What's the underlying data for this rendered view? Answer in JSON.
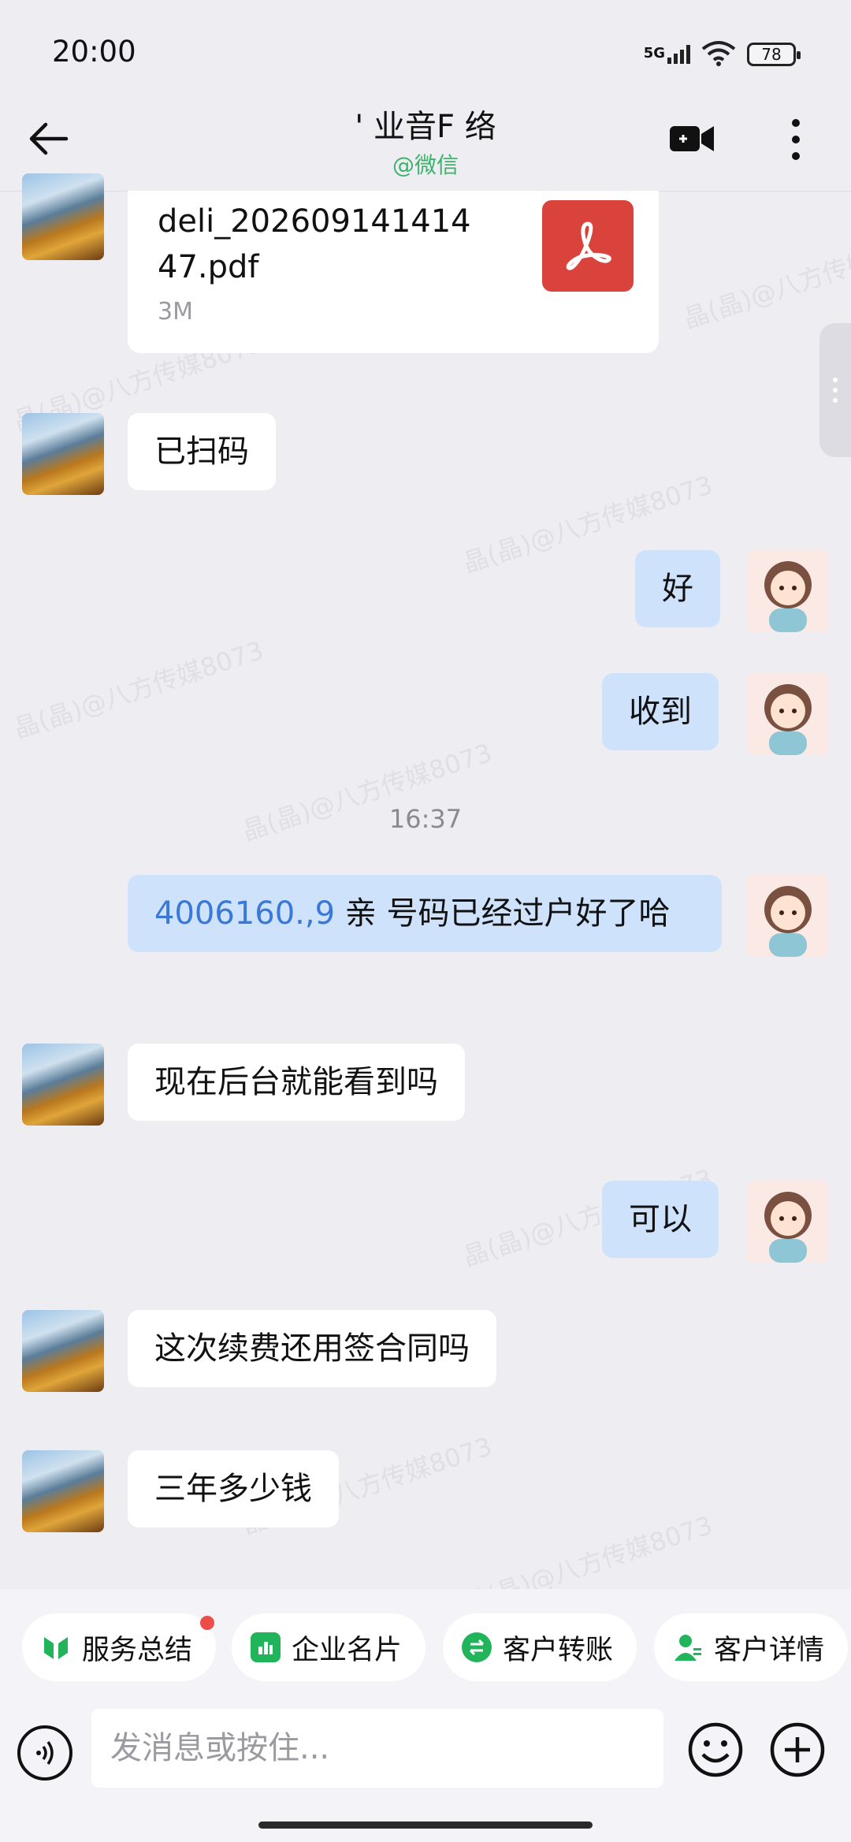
{
  "status_bar": {
    "time": "20:00",
    "network": "5G",
    "battery": "78"
  },
  "header": {
    "title": "' 业​音​F 络",
    "subtitle": "@微信"
  },
  "file_message": {
    "file_name": "deli_20260914141447.pdf",
    "file_size": "3M"
  },
  "messages": [
    {
      "side": "in",
      "text": "已扫码"
    },
    {
      "side": "out",
      "text": "好"
    },
    {
      "side": "out",
      "text": "收到"
    },
    {
      "side": "out",
      "phone": "4006160.,9",
      "text": " 亲 号码已经过户好了哈"
    },
    {
      "side": "in",
      "text": "现在后台就能看到吗"
    },
    {
      "side": "out",
      "text": "可以"
    },
    {
      "side": "in",
      "text": "这次续费还用签合同吗"
    },
    {
      "side": "in",
      "text": "三年多少钱"
    }
  ],
  "time_divider": "16:37",
  "watermark": "晶(晶)@八方传媒8073",
  "quick_actions": [
    {
      "label": "服务总结",
      "icon": "service-summary-icon",
      "color": "#21b45a"
    },
    {
      "label": "企业名片",
      "icon": "business-card-icon",
      "color": "#21b45a"
    },
    {
      "label": "客户转账",
      "icon": "transfer-icon",
      "color": "#21b45a"
    },
    {
      "label": "客户详情",
      "icon": "customer-detail-icon",
      "color": "#21b45a"
    }
  ],
  "input": {
    "placeholder": "发消息或按住..."
  },
  "colors": {
    "accent_green": "#3bb46b",
    "bubble_out": "#cfe2fb",
    "pdf_red": "#d9433b"
  }
}
